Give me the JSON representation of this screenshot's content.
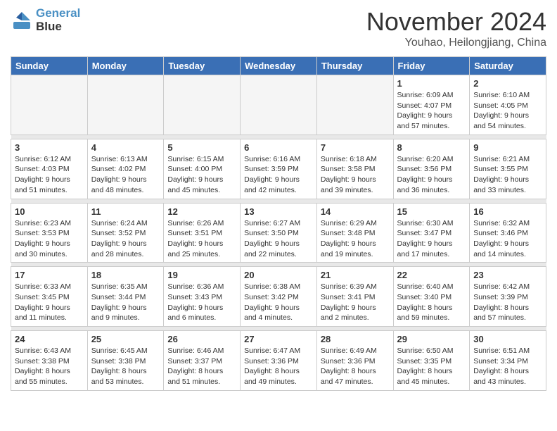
{
  "header": {
    "logo_line1": "General",
    "logo_line2": "Blue",
    "month": "November 2024",
    "location": "Youhao, Heilongjiang, China"
  },
  "weekdays": [
    "Sunday",
    "Monday",
    "Tuesday",
    "Wednesday",
    "Thursday",
    "Friday",
    "Saturday"
  ],
  "weeks": [
    [
      {
        "day": "",
        "info": ""
      },
      {
        "day": "",
        "info": ""
      },
      {
        "day": "",
        "info": ""
      },
      {
        "day": "",
        "info": ""
      },
      {
        "day": "",
        "info": ""
      },
      {
        "day": "1",
        "info": "Sunrise: 6:09 AM\nSunset: 4:07 PM\nDaylight: 9 hours and 57 minutes."
      },
      {
        "day": "2",
        "info": "Sunrise: 6:10 AM\nSunset: 4:05 PM\nDaylight: 9 hours and 54 minutes."
      }
    ],
    [
      {
        "day": "3",
        "info": "Sunrise: 6:12 AM\nSunset: 4:03 PM\nDaylight: 9 hours and 51 minutes."
      },
      {
        "day": "4",
        "info": "Sunrise: 6:13 AM\nSunset: 4:02 PM\nDaylight: 9 hours and 48 minutes."
      },
      {
        "day": "5",
        "info": "Sunrise: 6:15 AM\nSunset: 4:00 PM\nDaylight: 9 hours and 45 minutes."
      },
      {
        "day": "6",
        "info": "Sunrise: 6:16 AM\nSunset: 3:59 PM\nDaylight: 9 hours and 42 minutes."
      },
      {
        "day": "7",
        "info": "Sunrise: 6:18 AM\nSunset: 3:58 PM\nDaylight: 9 hours and 39 minutes."
      },
      {
        "day": "8",
        "info": "Sunrise: 6:20 AM\nSunset: 3:56 PM\nDaylight: 9 hours and 36 minutes."
      },
      {
        "day": "9",
        "info": "Sunrise: 6:21 AM\nSunset: 3:55 PM\nDaylight: 9 hours and 33 minutes."
      }
    ],
    [
      {
        "day": "10",
        "info": "Sunrise: 6:23 AM\nSunset: 3:53 PM\nDaylight: 9 hours and 30 minutes."
      },
      {
        "day": "11",
        "info": "Sunrise: 6:24 AM\nSunset: 3:52 PM\nDaylight: 9 hours and 28 minutes."
      },
      {
        "day": "12",
        "info": "Sunrise: 6:26 AM\nSunset: 3:51 PM\nDaylight: 9 hours and 25 minutes."
      },
      {
        "day": "13",
        "info": "Sunrise: 6:27 AM\nSunset: 3:50 PM\nDaylight: 9 hours and 22 minutes."
      },
      {
        "day": "14",
        "info": "Sunrise: 6:29 AM\nSunset: 3:48 PM\nDaylight: 9 hours and 19 minutes."
      },
      {
        "day": "15",
        "info": "Sunrise: 6:30 AM\nSunset: 3:47 PM\nDaylight: 9 hours and 17 minutes."
      },
      {
        "day": "16",
        "info": "Sunrise: 6:32 AM\nSunset: 3:46 PM\nDaylight: 9 hours and 14 minutes."
      }
    ],
    [
      {
        "day": "17",
        "info": "Sunrise: 6:33 AM\nSunset: 3:45 PM\nDaylight: 9 hours and 11 minutes."
      },
      {
        "day": "18",
        "info": "Sunrise: 6:35 AM\nSunset: 3:44 PM\nDaylight: 9 hours and 9 minutes."
      },
      {
        "day": "19",
        "info": "Sunrise: 6:36 AM\nSunset: 3:43 PM\nDaylight: 9 hours and 6 minutes."
      },
      {
        "day": "20",
        "info": "Sunrise: 6:38 AM\nSunset: 3:42 PM\nDaylight: 9 hours and 4 minutes."
      },
      {
        "day": "21",
        "info": "Sunrise: 6:39 AM\nSunset: 3:41 PM\nDaylight: 9 hours and 2 minutes."
      },
      {
        "day": "22",
        "info": "Sunrise: 6:40 AM\nSunset: 3:40 PM\nDaylight: 8 hours and 59 minutes."
      },
      {
        "day": "23",
        "info": "Sunrise: 6:42 AM\nSunset: 3:39 PM\nDaylight: 8 hours and 57 minutes."
      }
    ],
    [
      {
        "day": "24",
        "info": "Sunrise: 6:43 AM\nSunset: 3:38 PM\nDaylight: 8 hours and 55 minutes."
      },
      {
        "day": "25",
        "info": "Sunrise: 6:45 AM\nSunset: 3:38 PM\nDaylight: 8 hours and 53 minutes."
      },
      {
        "day": "26",
        "info": "Sunrise: 6:46 AM\nSunset: 3:37 PM\nDaylight: 8 hours and 51 minutes."
      },
      {
        "day": "27",
        "info": "Sunrise: 6:47 AM\nSunset: 3:36 PM\nDaylight: 8 hours and 49 minutes."
      },
      {
        "day": "28",
        "info": "Sunrise: 6:49 AM\nSunset: 3:36 PM\nDaylight: 8 hours and 47 minutes."
      },
      {
        "day": "29",
        "info": "Sunrise: 6:50 AM\nSunset: 3:35 PM\nDaylight: 8 hours and 45 minutes."
      },
      {
        "day": "30",
        "info": "Sunrise: 6:51 AM\nSunset: 3:34 PM\nDaylight: 8 hours and 43 minutes."
      }
    ]
  ]
}
